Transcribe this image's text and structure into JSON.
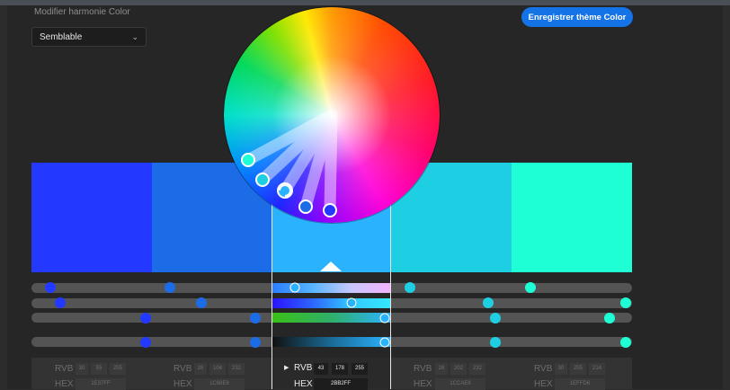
{
  "header": {
    "harmony_heading": "Modifier harmonie Color",
    "harmony_rule": "Semblable",
    "save_label": "Enregistrer thème Color"
  },
  "colors": {
    "accent": "#1473e6",
    "swatches": [
      "#2339ff",
      "#1c6ce8",
      "#2bb2ff",
      "#1ecfe4",
      "#1effd6"
    ]
  },
  "values": {
    "rvb_label": "RVB",
    "hex_label": "HEX",
    "swatches": [
      {
        "r": "30",
        "g": "55",
        "b": "255",
        "hex": "1E37FF"
      },
      {
        "r": "28",
        "g": "104",
        "b": "232",
        "hex": "1C68E8"
      },
      {
        "r": "43",
        "g": "178",
        "b": "255",
        "hex": "2BB2FF"
      },
      {
        "r": "28",
        "g": "202",
        "b": "232",
        "hex": "1CCAE8"
      },
      {
        "r": "30",
        "g": "255",
        "b": "214",
        "hex": "1EFFD6"
      }
    ]
  },
  "icons": {
    "dropdown": "chevron-down-icon",
    "expand": "triangle-right-icon"
  }
}
